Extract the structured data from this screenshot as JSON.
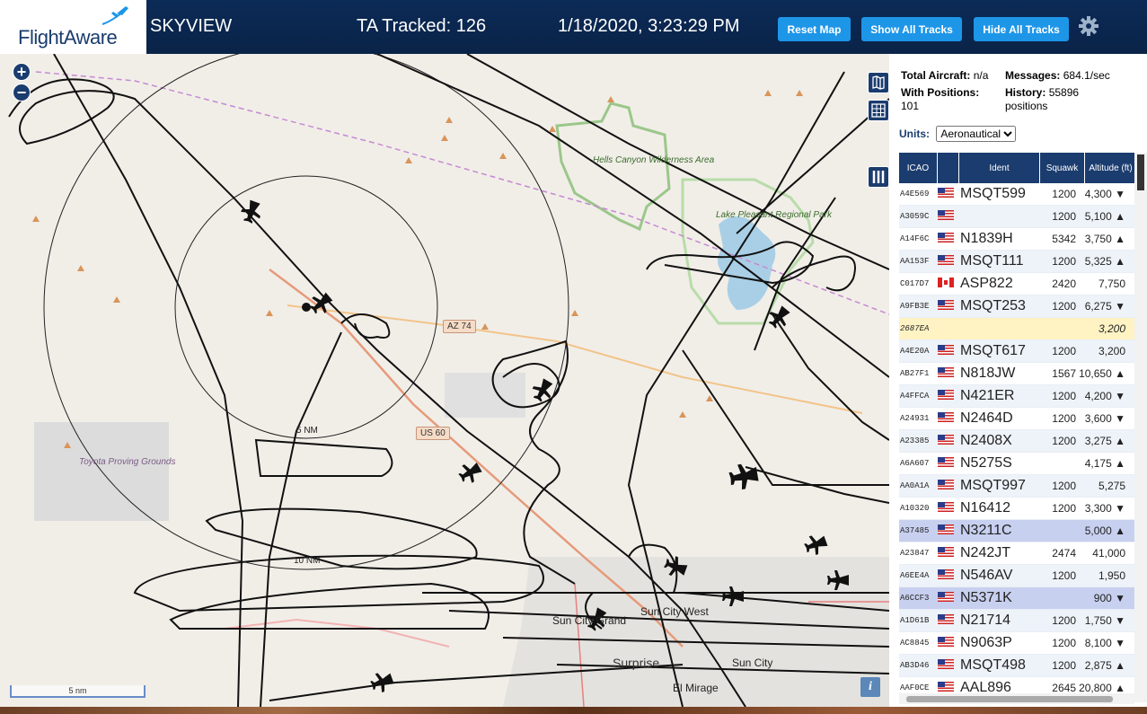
{
  "header": {
    "logo_text": "FlightAware",
    "site_name": "SKYVIEW",
    "ta_tracked": "TA Tracked: 126",
    "datetime": "1/18/2020, 3:23:29 PM",
    "buttons": {
      "reset": "Reset Map",
      "show_all": "Show All Tracks",
      "hide_all": "Hide All Tracks"
    },
    "settings_icon": "gear-icon"
  },
  "map": {
    "zoom_in": "+",
    "zoom_out": "−",
    "scale": "5 nm",
    "labels": {
      "hells_canyon": "Hells Canyon Wilderness Area",
      "lake_pleasant": "Lake Pleasant Regional Park",
      "toyota": "Toyota Proving Grounds",
      "az74": "AZ 74",
      "us60": "US 60",
      "ring5": "5 NM",
      "ring10": "10 NM",
      "sun_city_grand": "Sun City Grand",
      "sun_city_west": "Sun City West",
      "surprise": "Surprise",
      "sun_city": "Sun City",
      "el_mirage": "El Mirage"
    },
    "icons": [
      "layers-icon",
      "grid-icon",
      "columns-icon",
      "info-icon"
    ]
  },
  "panel": {
    "stats": {
      "total_label": "Total Aircraft:",
      "total_value": "n/a",
      "messages_label": "Messages:",
      "messages_value": "684.1/sec",
      "positions_label": "With Positions:",
      "positions_value": "101",
      "history_label": "History:",
      "history_value": "55896 positions"
    },
    "units_label": "Units:",
    "units_value": "Aeronautical",
    "columns": [
      "ICAO",
      "Ident",
      "Squawk",
      "Altitude (ft)"
    ],
    "rows": [
      {
        "icao": "A4E569",
        "flag": "us",
        "ident": "MSQT599",
        "squawk": "1200",
        "alt": "4,300 ▼"
      },
      {
        "icao": "A3059C",
        "flag": "us",
        "ident": "",
        "squawk": "1200",
        "alt": "5,100 ▲"
      },
      {
        "icao": "A14F6C",
        "flag": "us",
        "ident": "N1839H",
        "squawk": "5342",
        "alt": "3,750 ▲"
      },
      {
        "icao": "AA153F",
        "flag": "us",
        "ident": "MSQT111",
        "squawk": "1200",
        "alt": "5,325 ▲"
      },
      {
        "icao": "C017D7",
        "flag": "ca",
        "ident": "ASP822",
        "squawk": "2420",
        "alt": "7,750"
      },
      {
        "icao": "A9FB3E",
        "flag": "us",
        "ident": "MSQT253",
        "squawk": "1200",
        "alt": "6,275 ▼"
      },
      {
        "icao": "2687EA",
        "flag": "",
        "ident": "",
        "squawk": "",
        "alt": "3,200"
      },
      {
        "icao": "A4E20A",
        "flag": "us",
        "ident": "MSQT617",
        "squawk": "1200",
        "alt": "3,200"
      },
      {
        "icao": "AB27F1",
        "flag": "us",
        "ident": "N818JW",
        "squawk": "1567",
        "alt": "10,650 ▲"
      },
      {
        "icao": "A4FFCA",
        "flag": "us",
        "ident": "N421ER",
        "squawk": "1200",
        "alt": "4,200 ▼"
      },
      {
        "icao": "A24931",
        "flag": "us",
        "ident": "N2464D",
        "squawk": "1200",
        "alt": "3,600 ▼"
      },
      {
        "icao": "A23385",
        "flag": "us",
        "ident": "N2408X",
        "squawk": "1200",
        "alt": "3,275 ▲"
      },
      {
        "icao": "A6A607",
        "flag": "us",
        "ident": "N5275S",
        "squawk": "",
        "alt": "4,175 ▲"
      },
      {
        "icao": "AA0A1A",
        "flag": "us",
        "ident": "MSQT997",
        "squawk": "1200",
        "alt": "5,275"
      },
      {
        "icao": "A10320",
        "flag": "us",
        "ident": "N16412",
        "squawk": "1200",
        "alt": "3,300 ▼"
      },
      {
        "icao": "A37485",
        "flag": "us",
        "ident": "N3211C",
        "squawk": "",
        "alt": "5,000 ▲"
      },
      {
        "icao": "A23847",
        "flag": "us",
        "ident": "N242JT",
        "squawk": "2474",
        "alt": "41,000"
      },
      {
        "icao": "A6EE4A",
        "flag": "us",
        "ident": "N546AV",
        "squawk": "1200",
        "alt": "1,950"
      },
      {
        "icao": "A6CCF3",
        "flag": "us",
        "ident": "N5371K",
        "squawk": "",
        "alt": "900 ▼"
      },
      {
        "icao": "A1D61B",
        "flag": "us",
        "ident": "N21714",
        "squawk": "1200",
        "alt": "1,750 ▼"
      },
      {
        "icao": "AC8845",
        "flag": "us",
        "ident": "N9063P",
        "squawk": "1200",
        "alt": "8,100 ▼"
      },
      {
        "icao": "AB3D46",
        "flag": "us",
        "ident": "MSQT498",
        "squawk": "1200",
        "alt": "2,875 ▲"
      },
      {
        "icao": "AAF0CE",
        "flag": "us",
        "ident": "AAL896",
        "squawk": "2645",
        "alt": "20,800 ▲"
      }
    ]
  }
}
